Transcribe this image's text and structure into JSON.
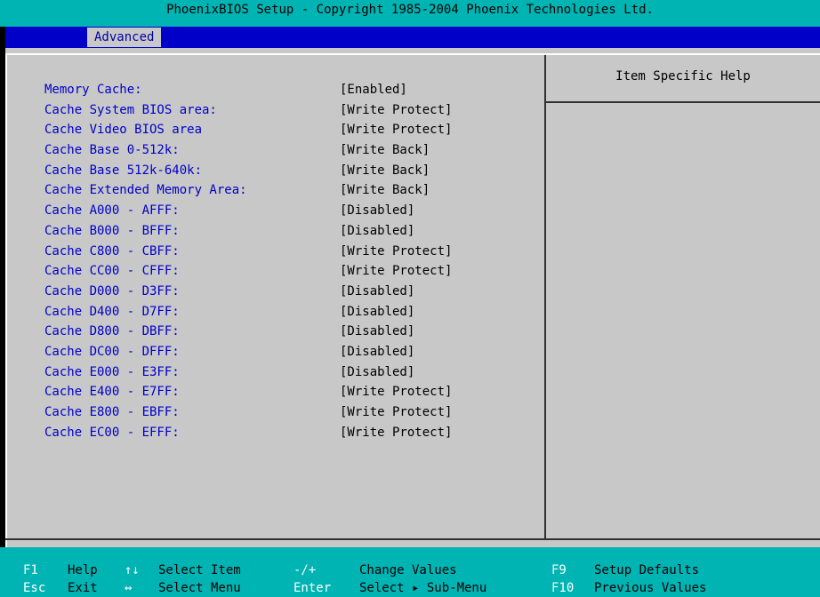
{
  "window": {
    "title": "PhoenixBIOS Setup - Copyright 1985-2004 Phoenix Technologies Ltd."
  },
  "menu": {
    "tabs": [
      {
        "label": "Advanced",
        "active": true
      }
    ]
  },
  "settings": [
    {
      "label": "Memory Cache:",
      "value": "[Enabled]"
    },
    {
      "label": "Cache System BIOS area:",
      "value": "[Write Protect]"
    },
    {
      "label": "Cache Video BIOS area",
      "value": "[Write Protect]"
    },
    {
      "label": "Cache Base 0-512k:",
      "value": "[Write Back]"
    },
    {
      "label": "Cache Base 512k-640k:",
      "value": "[Write Back]"
    },
    {
      "label": "Cache Extended Memory Area:",
      "value": "[Write Back]"
    },
    {
      "label": "Cache A000 - AFFF:",
      "value": "[Disabled]"
    },
    {
      "label": "Cache B000 - BFFF:",
      "value": "[Disabled]"
    },
    {
      "label": "Cache C800 - CBFF:",
      "value": "[Write Protect]"
    },
    {
      "label": "Cache CC00 - CFFF:",
      "value": "[Write Protect]"
    },
    {
      "label": "Cache D000 - D3FF:",
      "value": "[Disabled]"
    },
    {
      "label": "Cache D400 - D7FF:",
      "value": "[Disabled]"
    },
    {
      "label": "Cache D800 - DBFF:",
      "value": "[Disabled]"
    },
    {
      "label": "Cache DC00 - DFFF:",
      "value": "[Disabled]"
    },
    {
      "label": "Cache E000 - E3FF:",
      "value": "[Disabled]"
    },
    {
      "label": "Cache E400 - E7FF:",
      "value": "[Write Protect]"
    },
    {
      "label": "Cache E800 - EBFF:",
      "value": "[Write Protect]"
    },
    {
      "label": "Cache EC00 - EFFF:",
      "value": "[Write Protect]"
    }
  ],
  "help": {
    "title": "Item Specific Help"
  },
  "footer": {
    "f1_key": "F1",
    "f1_desc": "Help",
    "updown_key": "↑↓",
    "updown_desc": "Select Item",
    "minusplus_key": "-/+",
    "minusplus_desc": "Change Values",
    "f9_key": "F9",
    "f9_desc": "Setup Defaults",
    "esc_key": "Esc",
    "esc_desc": "Exit",
    "leftright_key": "↔",
    "leftright_desc": "Select Menu",
    "enter_key": "Enter",
    "enter_desc": "Select ▸ Sub-Menu",
    "f10_key": "F10",
    "f10_desc": "Previous Values"
  },
  "colors": {
    "title_bar": "#00b4b4",
    "menu_bar": "#0000c8",
    "panel": "#c8c8c8",
    "label_text": "#0000c8",
    "value_text": "#000000",
    "footer_key": "#ffffff"
  }
}
